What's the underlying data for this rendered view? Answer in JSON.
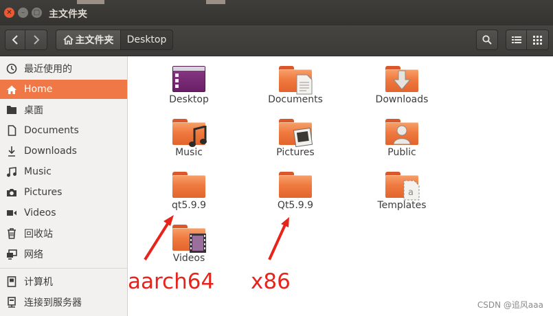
{
  "window": {
    "title": "主文件夹"
  },
  "toolbar": {
    "breadcrumb": [
      {
        "label": "主文件夹"
      },
      {
        "label": "Desktop"
      }
    ]
  },
  "sidebar": {
    "items": [
      {
        "label": "最近使用的",
        "icon": "clock-icon"
      },
      {
        "label": "Home",
        "icon": "home-icon",
        "active": true
      },
      {
        "label": "桌面",
        "icon": "folder-icon"
      },
      {
        "label": "Documents",
        "icon": "document-icon"
      },
      {
        "label": "Downloads",
        "icon": "download-icon"
      },
      {
        "label": "Music",
        "icon": "music-icon"
      },
      {
        "label": "Pictures",
        "icon": "camera-icon"
      },
      {
        "label": "Videos",
        "icon": "video-icon"
      },
      {
        "label": "回收站",
        "icon": "trash-icon"
      },
      {
        "label": "网络",
        "icon": "network-icon"
      },
      {
        "label": "计算机",
        "icon": "computer-icon"
      },
      {
        "label": "连接到服务器",
        "icon": "server-icon"
      }
    ]
  },
  "files": [
    {
      "name": "Desktop",
      "icon": "desktop-folder-icon"
    },
    {
      "name": "Documents",
      "icon": "documents-folder-icon"
    },
    {
      "name": "Downloads",
      "icon": "downloads-folder-icon"
    },
    {
      "name": "Music",
      "icon": "music-folder-icon"
    },
    {
      "name": "Pictures",
      "icon": "pictures-folder-icon"
    },
    {
      "name": "Public",
      "icon": "public-folder-icon"
    },
    {
      "name": "qt5.9.9",
      "icon": "folder-icon"
    },
    {
      "name": "Qt5.9.9",
      "icon": "folder-icon"
    },
    {
      "name": "Templates",
      "icon": "templates-folder-icon"
    },
    {
      "name": "Videos",
      "icon": "videos-folder-icon"
    }
  ],
  "annotations": [
    {
      "text": "aarch64"
    },
    {
      "text": "x86"
    }
  ],
  "watermark": "CSDN @追风aaa",
  "colors": {
    "accent": "#f07746",
    "annotation": "#e8231c",
    "titlebar": "#3c3b37",
    "sidebar": "#f2f1f0"
  }
}
